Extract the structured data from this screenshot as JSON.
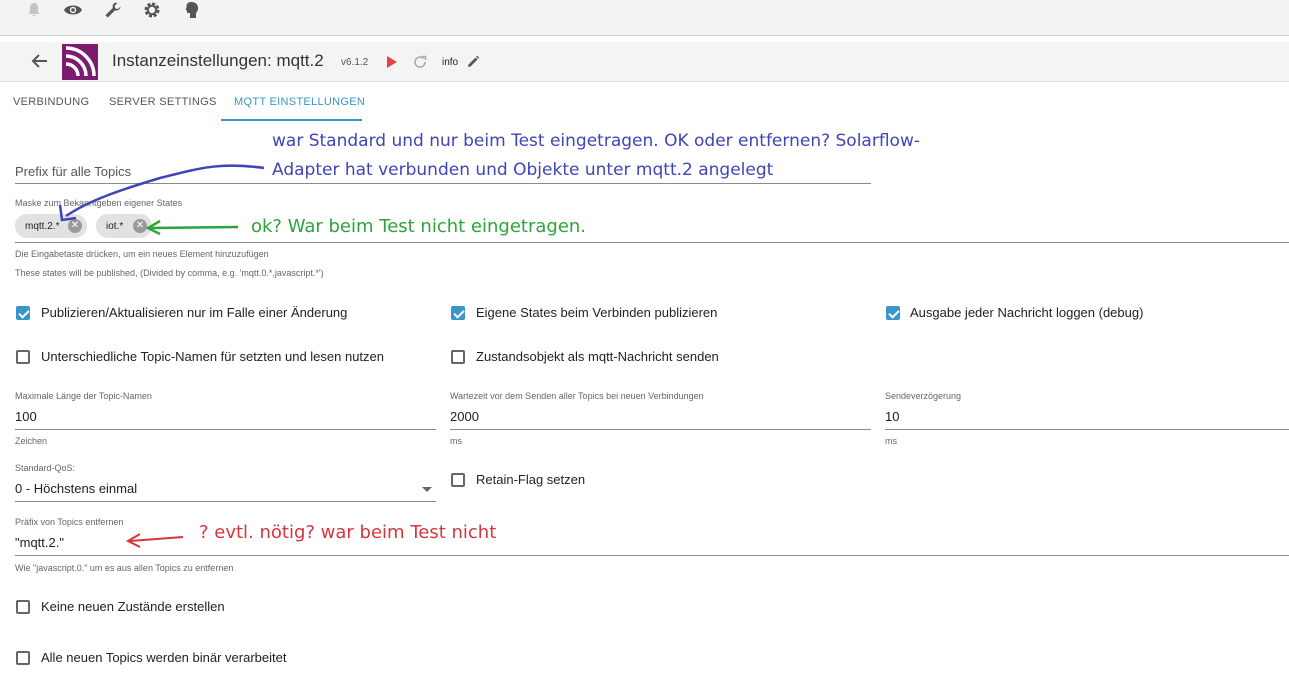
{
  "topbar": {
    "icons": [
      "bell-icon",
      "eye-icon",
      "wrench-icon",
      "gear-icon",
      "user-head-icon"
    ]
  },
  "header": {
    "title": "Instanzeinstellungen: mqtt.2",
    "version": "v6.1.2",
    "info_label": "info"
  },
  "tabs": [
    {
      "label": "VERBINDUNG"
    },
    {
      "label": "SERVER SETTINGS"
    },
    {
      "label": "MQTT EINSTELLUNGEN"
    }
  ],
  "prefix_field": {
    "placeholder": "Prefix für alle Topics"
  },
  "mask_field": {
    "label": "Maske zum Bekanntgeben eigener States",
    "chips": [
      "mqtt.2.*",
      "iot.*"
    ],
    "helper1": "Die Eingabetaste drücken, um ein neues Element hinzuzufügen",
    "helper2": "These states will be published, (Divided by comma, e.g. 'mqtt.0.*,javascript.*')"
  },
  "checkboxes": {
    "publish_on_change": {
      "label": "Publizieren/Aktualisieren nur im Falle einer Änderung",
      "checked": true
    },
    "publish_own_states": {
      "label": "Eigene States beim Verbinden publizieren",
      "checked": true
    },
    "log_messages": {
      "label": "Ausgabe jeder Nachricht loggen (debug)",
      "checked": true
    },
    "different_topic_names": {
      "label": "Unterschiedliche Topic-Namen für setzten und lesen nutzen",
      "checked": false
    },
    "state_object_as_message": {
      "label": "Zustandsobjekt als mqtt-Nachricht senden",
      "checked": false
    },
    "retain_flag": {
      "label": "Retain-Flag setzen",
      "checked": false
    },
    "no_new_states": {
      "label": "Keine neuen Zustände erstellen",
      "checked": false
    },
    "binary_topics": {
      "label": "Alle neuen Topics werden binär verarbeitet",
      "checked": false
    }
  },
  "fields": {
    "max_topic_length": {
      "label": "Maximale Länge der Topic-Namen",
      "value": "100",
      "unit": "Zeichen"
    },
    "wait_time": {
      "label": "Wartezeit vor dem Senden aller Topics bei neuen Verbindungen",
      "value": "2000",
      "unit": "ms"
    },
    "send_delay": {
      "label": "Sendeverzögerung",
      "value": "10",
      "unit": "ms"
    },
    "default_qos": {
      "label": "Standard-QoS:",
      "value": "0 - Höchstens einmal"
    },
    "remove_prefix": {
      "label": "Präfix von Topics entfernen",
      "value": "\"mqtt.2.\"",
      "helper": "Wie \"javascript.0.\" um es aus allen Topics zu entfernen"
    }
  },
  "annotations": {
    "blue_line1": "war Standard und nur beim Test eingetragen. OK oder entfernen? Solarflow-",
    "blue_line2": "Adapter hat verbunden und Objekte unter mqtt.2 angelegt",
    "green": "ok? War beim Test nicht eingetragen.",
    "red": "? evtl. nötig? war beim Test nicht"
  },
  "colors": {
    "accent": "#3a96c8",
    "logo": "#7b1c6e",
    "play": "#e0434b",
    "annotation_blue": "#3f45b8",
    "annotation_green": "#2ea43c",
    "annotation_red": "#d8353b"
  }
}
